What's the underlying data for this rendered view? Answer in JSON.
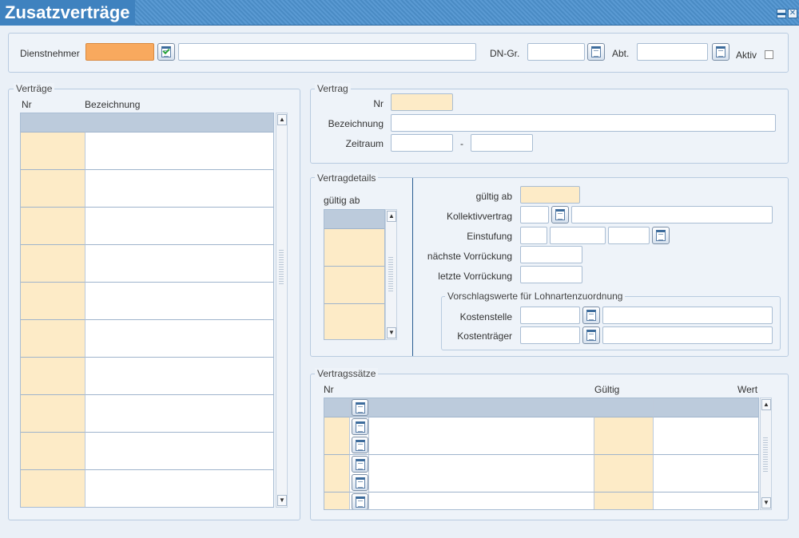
{
  "window": {
    "title": "Zusatzverträge"
  },
  "header": {
    "dienstnehmer_label": "Dienstnehmer",
    "dn_gr_label": "DN-Gr.",
    "abt_label": "Abt.",
    "aktiv_label": "Aktiv"
  },
  "vertraege": {
    "legend": "Verträge",
    "col_nr": "Nr",
    "col_bezeichnung": "Bezeichnung"
  },
  "vertrag": {
    "legend": "Vertrag",
    "nr_label": "Nr",
    "bezeichnung_label": "Bezeichnung",
    "zeitraum_label": "Zeitraum",
    "zeitraum_sep": "-"
  },
  "vertragdetails": {
    "legend": "Vertragdetails",
    "list_header": "gültig ab",
    "gueltig_ab_label": "gültig ab",
    "kollektivvertrag_label": "Kollektivvertrag",
    "einstufung_label": "Einstufung",
    "naechste_label": "nächste Vorrückung",
    "letzte_label": "letzte Vorrückung",
    "vorschlag_legend": "Vorschlagswerte für Lohnartenzuordnung",
    "kostenstelle_label": "Kostenstelle",
    "kostentraeger_label": "Kostenträger"
  },
  "vertragssaetze": {
    "legend": "Vertragssätze",
    "col_nr": "Nr",
    "col_gueltig": "Gültig",
    "col_wert": "Wert"
  },
  "icons": {
    "calendar": "calendar-icon",
    "check": "check-icon"
  },
  "colors": {
    "title_bar": "#3f82bf",
    "required_field": "#f8a95e",
    "key_field": "#fdebc7",
    "grid_header": "#bccbdc"
  }
}
